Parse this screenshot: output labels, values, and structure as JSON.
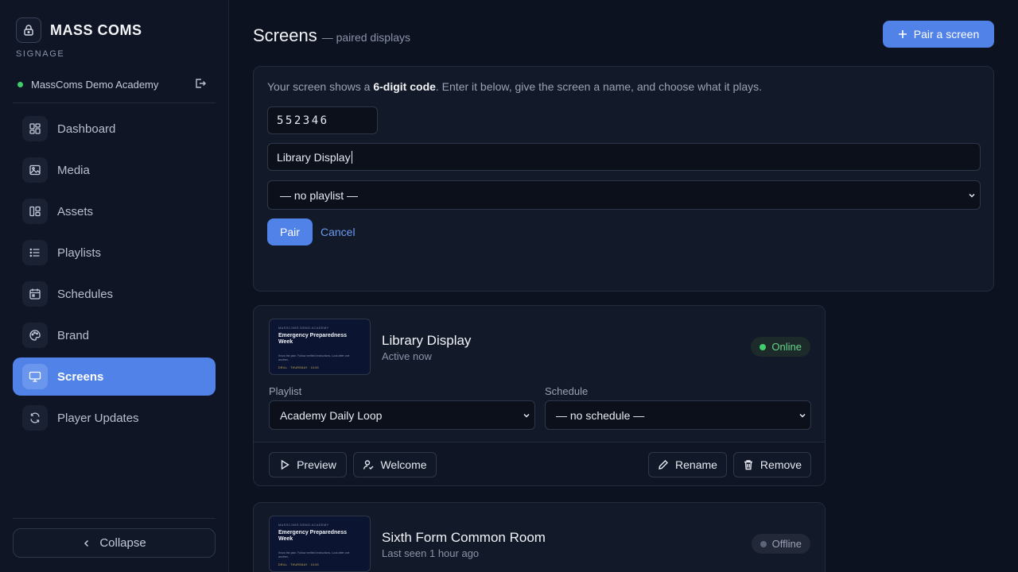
{
  "app": {
    "name": "MASS COMS",
    "subtitle": "SIGNAGE",
    "org": "MassComs Demo Academy"
  },
  "sidebar": {
    "items": [
      {
        "label": "Dashboard",
        "icon": "dashboard-icon",
        "active": false
      },
      {
        "label": "Media",
        "icon": "image-icon",
        "active": false
      },
      {
        "label": "Assets",
        "icon": "assets-icon",
        "active": false
      },
      {
        "label": "Playlists",
        "icon": "list-icon",
        "active": false
      },
      {
        "label": "Schedules",
        "icon": "calendar-icon",
        "active": false
      },
      {
        "label": "Brand",
        "icon": "palette-icon",
        "active": false
      },
      {
        "label": "Screens",
        "icon": "monitor-icon",
        "active": true
      },
      {
        "label": "Player Updates",
        "icon": "refresh-icon",
        "active": false
      }
    ],
    "collapse_label": "Collapse"
  },
  "header": {
    "title": "Screens",
    "subtitle": "— paired displays",
    "pair_button": "Pair a screen"
  },
  "pair_form": {
    "intro_before": "Your screen shows a ",
    "intro_bold": "6-digit code",
    "intro_after": ". Enter it below, give the screen a name, and choose what it plays.",
    "code_value": "552346",
    "name_value": "Library Display",
    "playlist_value": "— no playlist —",
    "pair_label": "Pair",
    "cancel_label": "Cancel"
  },
  "thumbnail": {
    "academy": "MASSCOMS DEMO ACADEMY",
    "title": "Emergency Preparedness Week",
    "body": "Know the plan. Follow verified instructions. Look after one another.",
    "footer": "DRILL · THURSDAY · 10:00"
  },
  "screens": [
    {
      "name": "Library Display",
      "seen": "Active now",
      "status": "Online",
      "playlist_label": "Playlist",
      "playlist_value": "Academy Daily Loop",
      "schedule_label": "Schedule",
      "schedule_value": "— no schedule —",
      "actions": {
        "preview": "Preview",
        "welcome": "Welcome",
        "rename": "Rename",
        "remove": "Remove"
      }
    },
    {
      "name": "Sixth Form Common Room",
      "seen": "Last seen 1 hour ago",
      "status": "Offline"
    }
  ],
  "colors": {
    "accent": "#5082e8",
    "online": "#3ecf6b",
    "background": "#0d1220"
  }
}
